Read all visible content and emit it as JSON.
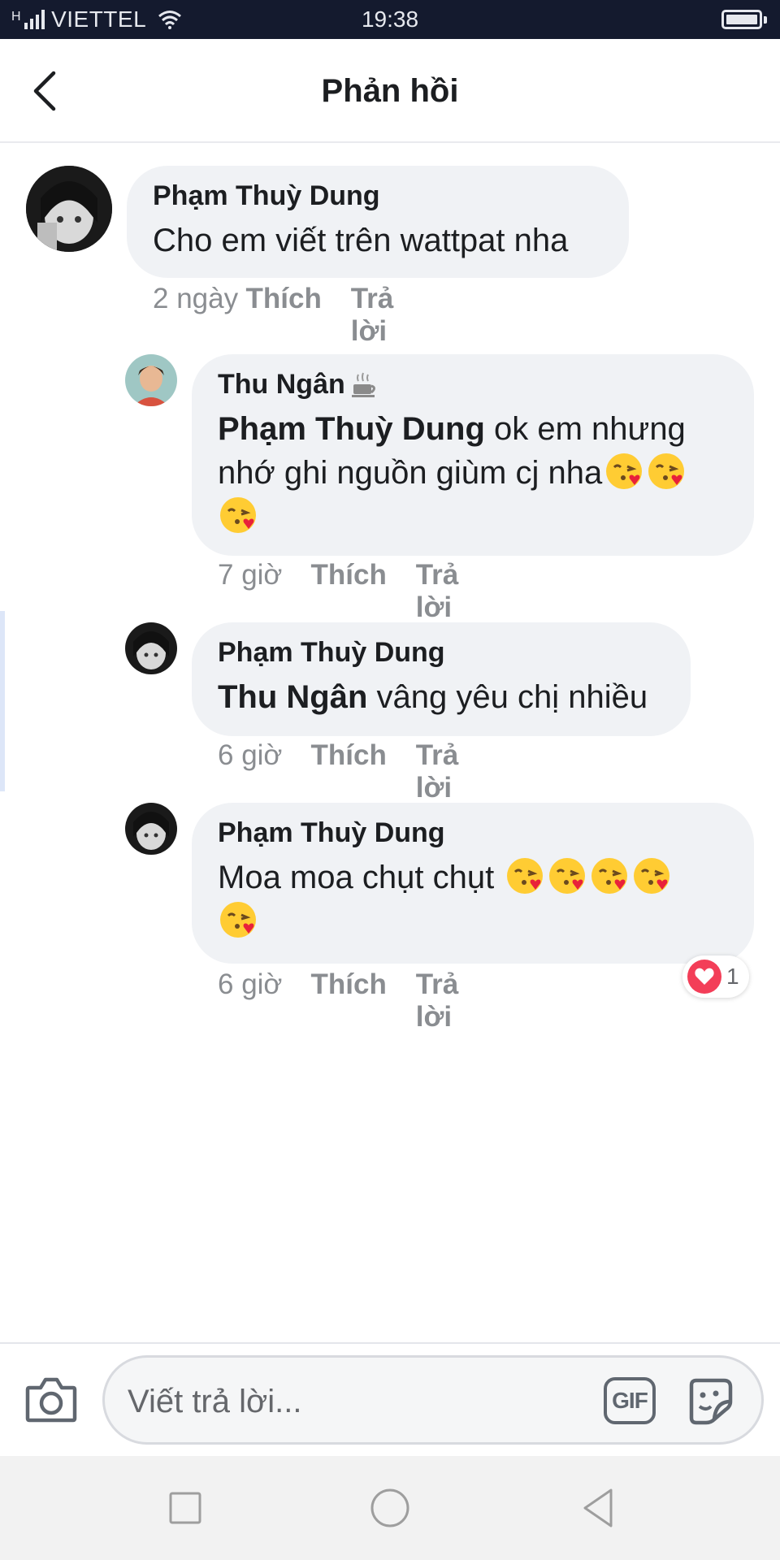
{
  "status_bar": {
    "carrier": "VIETTEL",
    "time": "19:38",
    "network_type": "H"
  },
  "header": {
    "title": "Phản hồi",
    "back_icon": "chevron-left-icon"
  },
  "comments": [
    {
      "author": "Phạm Thuỳ Dung",
      "text": "Cho em viết trên wattpat nha",
      "time": "2 ngày",
      "like_label": "Thích",
      "reply_label": "Trả lời"
    },
    {
      "author": "Thu Ngân",
      "author_icon": "coffee-cup-icon",
      "mention": "Phạm Thuỳ Dung",
      "text_line1": " ok em nhưng",
      "text_line2": "nhớ ghi nguồn giùm cj nha",
      "emoji_icon": "face-blowing-kiss-emoji",
      "time": "7 giờ",
      "like_label": "Thích",
      "reply_label": "Trả lời"
    },
    {
      "author": "Phạm Thuỳ Dung",
      "mention": "Thu Ngân",
      "text": " vâng yêu chị nhiều",
      "time": "6 giờ",
      "like_label": "Thích",
      "reply_label": "Trả lời"
    },
    {
      "author": "Phạm Thuỳ Dung",
      "text": "Moa moa chụt chụt ",
      "emoji_icon": "face-blowing-kiss-emoji",
      "time": "6 giờ",
      "like_label": "Thích",
      "reply_label": "Trả lời",
      "reaction": {
        "icon": "heart-icon",
        "count": "1",
        "color": "#f33e58"
      }
    }
  ],
  "composer": {
    "placeholder": "Viết trả lời...",
    "gif_label": "GIF",
    "camera_icon": "camera-icon",
    "sticker_icon": "sticker-icon"
  },
  "colors": {
    "status_bar_bg": "#141a2e",
    "bubble_bg": "#f0f2f5",
    "meta_text": "#8a8d91",
    "reaction_heart": "#f33e58"
  }
}
